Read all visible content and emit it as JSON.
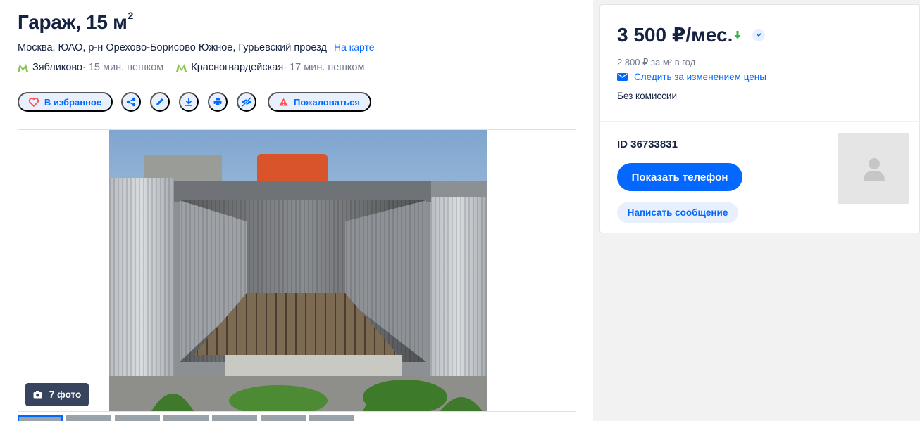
{
  "listing": {
    "title": "Гараж, 15 м",
    "title_sup": "2",
    "address": "Москва, ЮАО, р-н Орехово-Борисово Южное, Гурьевский проезд",
    "map_link": "На карте",
    "metro": [
      {
        "name": "Зябликово",
        "time": " · 15 мин. пешком"
      },
      {
        "name": "Красногвардейская",
        "time": " · 17 мин. пешком"
      }
    ],
    "metro_color": "#8bc34a"
  },
  "actions": {
    "favorite_label": "В избранное",
    "report_label": "Пожаловаться",
    "icons": [
      "heart-icon",
      "share-icon",
      "pencil-icon",
      "download-icon",
      "print-icon",
      "hide-icon",
      "warning-icon"
    ]
  },
  "gallery": {
    "photo_count_label": "7 фото",
    "thumb_count": 7
  },
  "price_card": {
    "price": "3 500 ₽/мес.",
    "price_per_m": "2 800 ₽ за м² в год",
    "follow_label": "Следить за изменением цены",
    "commission": "Без комиссии",
    "trend_color": "#2fb73f"
  },
  "contact_card": {
    "offer_id": "ID 36733831",
    "show_phone": "Показать телефон",
    "write_message": "Написать сообщение"
  },
  "colors": {
    "accent": "#0468ff",
    "accent_light": "#e8f0fd",
    "text": "#152242",
    "muted": "#737a8e",
    "danger": "#ff5050"
  }
}
